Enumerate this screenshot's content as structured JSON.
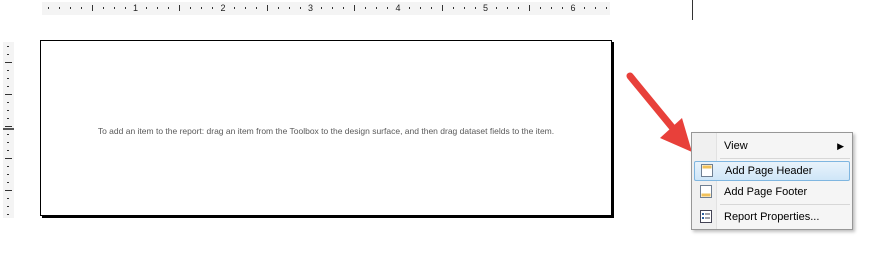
{
  "ruler": {
    "marks": [
      "1",
      "2",
      "3",
      "4",
      "5",
      "6"
    ]
  },
  "design_surface": {
    "hint": "To add an item to the report: drag an item from the Toolbox to the design surface, and then drag dataset fields to the item."
  },
  "context_menu": {
    "view_label": "View",
    "add_page_header_label": "Add Page Header",
    "add_page_footer_label": "Add Page Footer",
    "report_properties_label": "Report Properties..."
  },
  "colors": {
    "arrow": "#e8403a",
    "highlight": "#cfe6f8"
  },
  "icons": [
    "chevron-right-icon",
    "page-header-icon",
    "page-footer-icon",
    "report-properties-icon",
    "red-arrow-icon"
  ]
}
